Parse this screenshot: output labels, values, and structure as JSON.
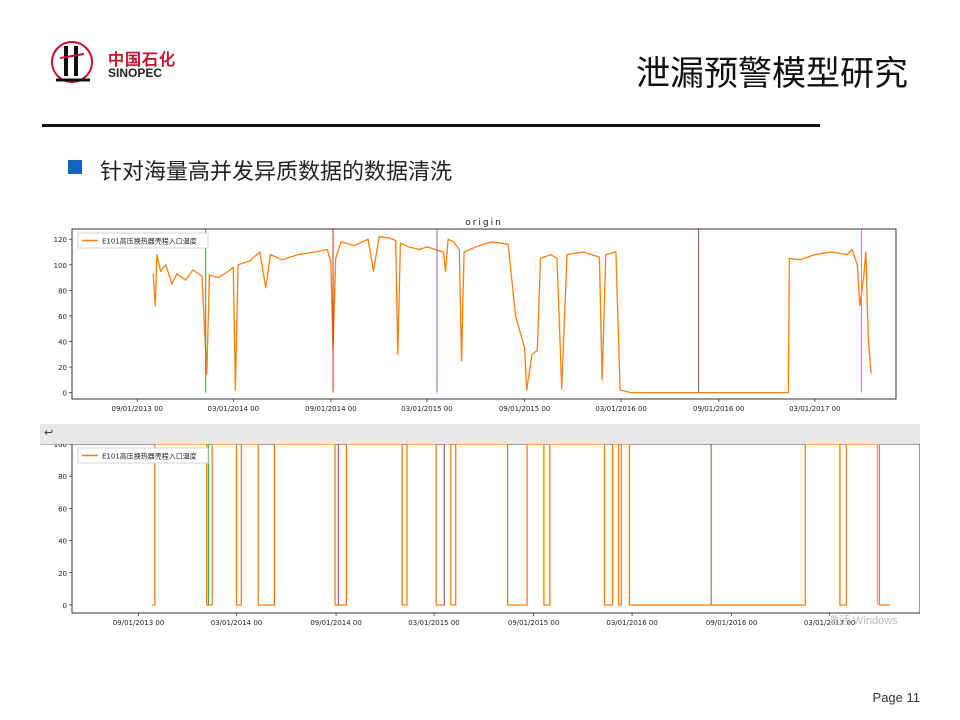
{
  "header": {
    "logo_cn": "中国石化",
    "logo_en": "SINOPEC",
    "title": "泄漏预警模型研究"
  },
  "bullet": {
    "text": "针对海量高并发异质数据的数据清洗"
  },
  "footer": {
    "page": "Page 11",
    "watermark": "激活 Windows"
  },
  "colors": {
    "series": "#ff7f0e",
    "bullet": "#1565c0",
    "brand_red": "#c8102e",
    "vline_green": "#2ca02c",
    "vline_red": "#d62728",
    "vline_purple": "#9467bd",
    "vline_brown": "#8c564b",
    "vline_pink": "#e377c2"
  },
  "chart_data": [
    {
      "type": "line",
      "title": "origin",
      "legend": "top-left",
      "x_tick_labels": [
        "09/01/2013 00",
        "03/01/2014 00",
        "09/01/2014 00",
        "03/01/2015 00",
        "09/01/2015 00",
        "03/01/2016 00",
        "09/01/2016 00",
        "03/01/2017 00"
      ],
      "x_ticks": [
        "2013-09-01",
        "2014-03-01",
        "2014-09-01",
        "2015-03-01",
        "2015-09-01",
        "2016-03-01",
        "2016-09-01",
        "2017-03-01"
      ],
      "xlim": [
        "2013-05-01",
        "2017-08-01"
      ],
      "ylim": [
        -5,
        128
      ],
      "y_ticks": [
        0,
        20,
        40,
        60,
        80,
        100,
        120
      ],
      "series": [
        {
          "name": "E101高压换热器壳程入口温度",
          "points": [
            [
              "2013-10-01",
              93
            ],
            [
              "2013-10-05",
              68
            ],
            [
              "2013-10-08",
              108
            ],
            [
              "2013-10-15",
              95
            ],
            [
              "2013-10-25",
              100
            ],
            [
              "2013-11-05",
              85
            ],
            [
              "2013-11-15",
              93
            ],
            [
              "2013-12-01",
              88
            ],
            [
              "2013-12-15",
              96
            ],
            [
              "2014-01-01",
              91
            ],
            [
              "2014-01-10",
              14
            ],
            [
              "2014-01-15",
              92
            ],
            [
              "2014-02-01",
              90
            ],
            [
              "2014-02-20",
              95
            ],
            [
              "2014-03-01",
              98
            ],
            [
              "2014-03-05",
              2
            ],
            [
              "2014-03-10",
              100
            ],
            [
              "2014-04-01",
              103
            ],
            [
              "2014-04-20",
              110
            ],
            [
              "2014-05-01",
              82
            ],
            [
              "2014-05-10",
              108
            ],
            [
              "2014-06-01",
              104
            ],
            [
              "2014-07-01",
              108
            ],
            [
              "2014-08-01",
              110
            ],
            [
              "2014-08-25",
              112
            ],
            [
              "2014-09-01",
              102
            ],
            [
              "2014-09-05",
              33
            ],
            [
              "2014-09-10",
              105
            ],
            [
              "2014-09-20",
              118
            ],
            [
              "2014-10-15",
              115
            ],
            [
              "2014-11-10",
              120
            ],
            [
              "2014-11-20",
              95
            ],
            [
              "2014-12-01",
              122
            ],
            [
              "2014-12-20",
              121
            ],
            [
              "2015-01-01",
              119
            ],
            [
              "2015-01-05",
              30
            ],
            [
              "2015-01-10",
              117
            ],
            [
              "2015-01-25",
              114
            ],
            [
              "2015-02-15",
              112
            ],
            [
              "2015-03-01",
              114
            ],
            [
              "2015-04-01",
              110
            ],
            [
              "2015-04-05",
              95
            ],
            [
              "2015-04-10",
              120
            ],
            [
              "2015-04-20",
              118
            ],
            [
              "2015-05-01",
              112
            ],
            [
              "2015-05-05",
              25
            ],
            [
              "2015-05-10",
              110
            ],
            [
              "2015-06-01",
              114
            ],
            [
              "2015-07-01",
              118
            ],
            [
              "2015-08-01",
              116
            ],
            [
              "2015-08-15",
              60
            ],
            [
              "2015-09-01",
              35
            ],
            [
              "2015-09-05",
              2
            ],
            [
              "2015-09-15",
              30
            ],
            [
              "2015-09-25",
              33
            ],
            [
              "2015-10-01",
              105
            ],
            [
              "2015-10-20",
              108
            ],
            [
              "2015-11-01",
              105
            ],
            [
              "2015-11-10",
              3
            ],
            [
              "2015-11-20",
              108
            ],
            [
              "2015-12-20",
              110
            ],
            [
              "2016-01-20",
              106
            ],
            [
              "2016-01-25",
              10
            ],
            [
              "2016-02-01",
              108
            ],
            [
              "2016-02-20",
              110
            ],
            [
              "2016-02-28",
              2
            ],
            [
              "2016-03-20",
              0
            ],
            [
              "2016-09-01",
              0
            ],
            [
              "2017-01-10",
              0
            ],
            [
              "2017-01-12",
              105
            ],
            [
              "2017-02-01",
              104
            ],
            [
              "2017-03-01",
              108
            ],
            [
              "2017-04-01",
              110
            ],
            [
              "2017-05-01",
              108
            ],
            [
              "2017-05-10",
              112
            ],
            [
              "2017-05-20",
              100
            ],
            [
              "2017-05-25",
              68
            ],
            [
              "2017-06-01",
              90
            ],
            [
              "2017-06-05",
              110
            ],
            [
              "2017-06-10",
              40
            ],
            [
              "2017-06-15",
              15
            ]
          ]
        }
      ],
      "vlines": [
        {
          "x": "2014-01-08",
          "color": "#2ca02c"
        },
        {
          "x": "2014-09-05",
          "color": "#d62728"
        },
        {
          "x": "2015-03-20",
          "color": "#9467bd"
        },
        {
          "x": "2016-07-25",
          "color": "#8c564b"
        },
        {
          "x": "2017-05-28",
          "color": "#e377c2"
        }
      ]
    },
    {
      "type": "line",
      "title": "",
      "legend": "top-left",
      "x_tick_labels": [
        "09/01/2013 00",
        "03/01/2014 00",
        "09/01/2014 00",
        "03/01/2015 00",
        "09/01/2015 00",
        "03/01/2016 00",
        "09/01/2016 00",
        "03/01/2017 00"
      ],
      "x_ticks": [
        "2013-09-01",
        "2014-03-01",
        "2014-09-01",
        "2015-03-01",
        "2015-09-01",
        "2016-03-01",
        "2016-09-01",
        "2017-03-01"
      ],
      "xlim": [
        "2013-05-01",
        "2017-08-15"
      ],
      "ylim": [
        -5,
        100
      ],
      "y_ticks": [
        0,
        20,
        40,
        60,
        80,
        100
      ],
      "series": [
        {
          "name": "E101高压换热器壳程入口温度",
          "points": [
            [
              "2013-09-25",
              0
            ],
            [
              "2013-10-01",
              0
            ],
            [
              "2013-10-01",
              100
            ],
            [
              "2014-01-05",
              100
            ],
            [
              "2014-01-05",
              0
            ],
            [
              "2014-01-15",
              0
            ],
            [
              "2014-01-15",
              100
            ],
            [
              "2014-03-01",
              100
            ],
            [
              "2014-03-01",
              0
            ],
            [
              "2014-03-10",
              0
            ],
            [
              "2014-03-10",
              100
            ],
            [
              "2014-04-10",
              100
            ],
            [
              "2014-04-10",
              0
            ],
            [
              "2014-05-10",
              0
            ],
            [
              "2014-05-10",
              100
            ],
            [
              "2014-08-30",
              100
            ],
            [
              "2014-08-30",
              0
            ],
            [
              "2014-09-20",
              0
            ],
            [
              "2014-09-20",
              100
            ],
            [
              "2015-01-01",
              100
            ],
            [
              "2015-01-01",
              0
            ],
            [
              "2015-01-10",
              0
            ],
            [
              "2015-01-10",
              100
            ],
            [
              "2015-03-05",
              100
            ],
            [
              "2015-03-05",
              0
            ],
            [
              "2015-03-20",
              0
            ],
            [
              "2015-03-20",
              100
            ],
            [
              "2015-04-01",
              100
            ],
            [
              "2015-04-01",
              0
            ],
            [
              "2015-04-10",
              0
            ],
            [
              "2015-04-10",
              100
            ],
            [
              "2015-07-15",
              100
            ],
            [
              "2015-07-15",
              0
            ],
            [
              "2015-08-20",
              0
            ],
            [
              "2015-08-20",
              100
            ],
            [
              "2015-09-20",
              100
            ],
            [
              "2015-09-20",
              0
            ],
            [
              "2015-10-01",
              0
            ],
            [
              "2015-10-01",
              100
            ],
            [
              "2016-01-10",
              100
            ],
            [
              "2016-01-10",
              0
            ],
            [
              "2016-01-25",
              0
            ],
            [
              "2016-01-25",
              100
            ],
            [
              "2016-02-05",
              100
            ],
            [
              "2016-02-05",
              0
            ],
            [
              "2016-02-10",
              0
            ],
            [
              "2016-02-10",
              100
            ],
            [
              "2016-02-25",
              100
            ],
            [
              "2016-02-25",
              0
            ],
            [
              "2017-01-15",
              0
            ],
            [
              "2017-01-15",
              100
            ],
            [
              "2017-03-20",
              100
            ],
            [
              "2017-03-20",
              0
            ],
            [
              "2017-04-01",
              0
            ],
            [
              "2017-04-01",
              100
            ],
            [
              "2017-06-01",
              100
            ],
            [
              "2017-06-01",
              0
            ],
            [
              "2017-06-20",
              0
            ]
          ]
        }
      ],
      "vlines": [
        {
          "x": "2014-01-08",
          "color": "#2ca02c"
        },
        {
          "x": "2014-09-05",
          "color": "#d62728"
        },
        {
          "x": "2015-03-20",
          "color": "#9467bd"
        },
        {
          "x": "2016-07-25",
          "color": "#8c564b"
        },
        {
          "x": "2017-05-28",
          "color": "#e377c2"
        }
      ]
    }
  ]
}
